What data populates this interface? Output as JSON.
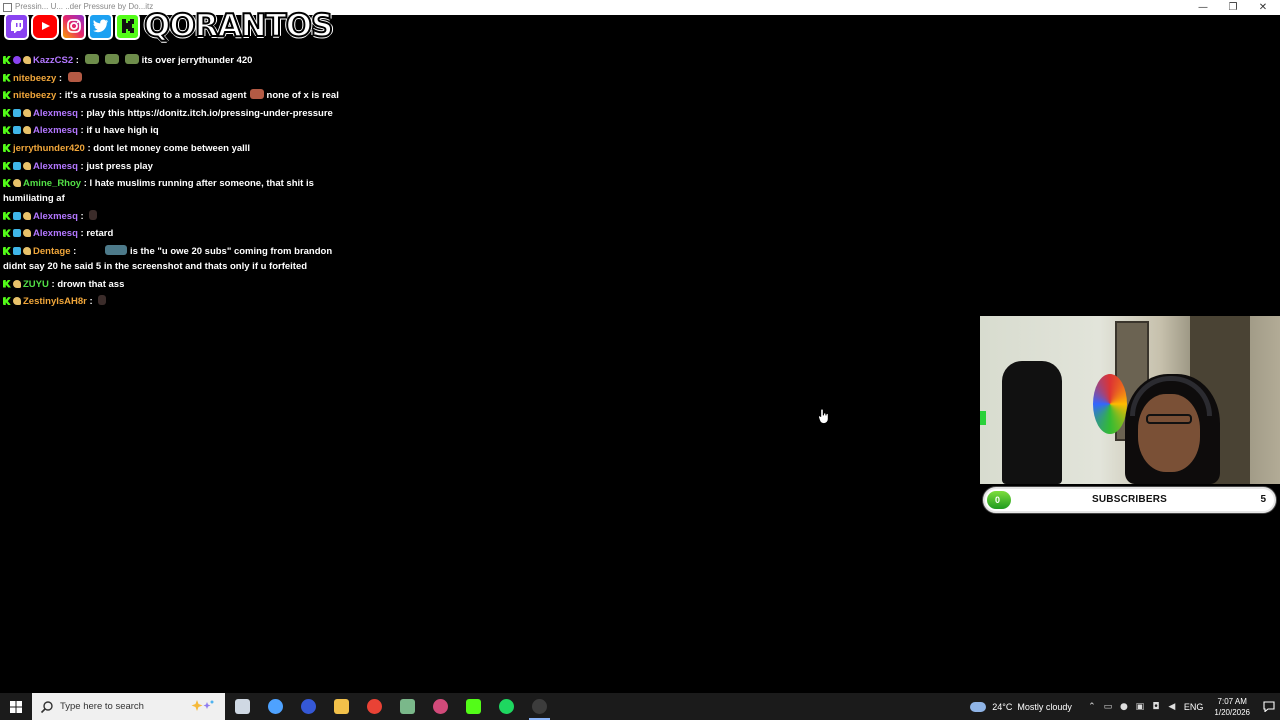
{
  "window": {
    "title": "Pressin... U... ..der Pressure by Do...itz",
    "minimize_glyph": "—",
    "maximize_glyph": "❐",
    "close_glyph": "✕"
  },
  "overlay": {
    "logo_text": "QORANTOS",
    "social_icons": [
      "twitch-icon",
      "youtube-icon",
      "instagram-icon",
      "twitter-icon",
      "kick-icon"
    ]
  },
  "chat": {
    "messages": [
      {
        "user": "KazzCS2",
        "color": "#b377ff",
        "badges": [
          "kick",
          "purple",
          "hand"
        ],
        "emotes_before": 3,
        "text": "its over jerrythunder 420"
      },
      {
        "user": "nitebeezy",
        "color": "#f0a63a",
        "badges": [
          "kick"
        ],
        "emotes_before": 1,
        "text": ""
      },
      {
        "user": "nitebeezy",
        "color": "#f0a63a",
        "badges": [
          "kick"
        ],
        "text": "it's a russia speaking to a mossad agent",
        "emote_mid": true,
        "text2": "none of x is real"
      },
      {
        "user": "Alexmesq",
        "color": "#b377ff",
        "badges": [
          "kick",
          "blue",
          "hand"
        ],
        "text": "play this https://donitz.itch.io/pressing-under-pressure"
      },
      {
        "user": "Alexmesq",
        "color": "#b377ff",
        "badges": [
          "kick",
          "blue",
          "hand"
        ],
        "text": "if u have high iq"
      },
      {
        "user": "jerrythunder420",
        "color": "#f0a63a",
        "badges": [
          "kick"
        ],
        "text": "dont let money come between yalll"
      },
      {
        "user": "Alexmesq",
        "color": "#b377ff",
        "badges": [
          "kick",
          "blue",
          "hand"
        ],
        "text": "just press play"
      },
      {
        "user": "Amine_Rhoy",
        "color": "#53e046",
        "badges": [
          "kick",
          "hand"
        ],
        "text": "I hate muslims running after someone, that shit is humiliating af"
      },
      {
        "user": "Alexmesq",
        "color": "#b377ff",
        "badges": [
          "kick",
          "blue",
          "hand"
        ],
        "emotes_before": 1,
        "text": ""
      },
      {
        "user": "Alexmesq",
        "color": "#b377ff",
        "badges": [
          "kick",
          "blue",
          "hand"
        ],
        "text": "retard"
      },
      {
        "user": "Dentage",
        "color": "#f0a63a",
        "badges": [
          "kick",
          "blue",
          "hand"
        ],
        "wide_emote": true,
        "text": "is the \"u owe 20 subs\" coming from brandon didnt say 20 he said 5 in the screenshot and thats only if u forfeited"
      },
      {
        "user": "ZUYU",
        "color": "#53e046",
        "badges": [
          "kick",
          "hand"
        ],
        "text": "drown that ass"
      },
      {
        "user": "ZestinyIsAH8r",
        "color": "#f0a63a",
        "badges": [
          "kick",
          "hand"
        ],
        "emotes_before": 1,
        "text": ""
      }
    ]
  },
  "subscriber_bar": {
    "label": "SUBSCRIBERS",
    "start": "0",
    "goal": "5",
    "progress": 0.05
  },
  "taskbar": {
    "search_placeholder": "Type here to search",
    "apps": [
      {
        "name": "task-view",
        "color": "#cfd8e3"
      },
      {
        "name": "copilot",
        "color": "#4ea2ff"
      },
      {
        "name": "app-blue-circle",
        "color": "#3558d6"
      },
      {
        "name": "file-explorer",
        "color": "#f2c14a"
      },
      {
        "name": "chrome",
        "color": "#e94235"
      },
      {
        "name": "app-green-box",
        "color": "#7ab88a"
      },
      {
        "name": "discord-like",
        "color": "#d14a7a"
      },
      {
        "name": "kick",
        "color": "#53fc18"
      },
      {
        "name": "spotify",
        "color": "#1ed760"
      },
      {
        "name": "obs",
        "color": "#3c3c3c",
        "active": true
      }
    ],
    "weather": {
      "temp": "24°C",
      "condition": "Mostly cloudy"
    },
    "language": "ENG",
    "time": "7:07 AM",
    "date": "1/20/2026"
  }
}
